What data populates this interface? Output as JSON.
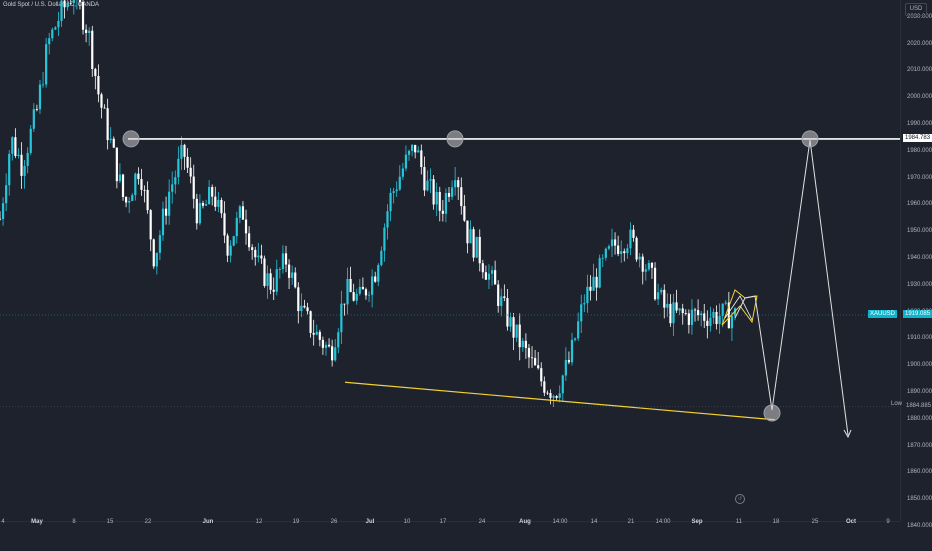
{
  "header": {
    "symbol_title": "Gold Spot / U.S. Dollar, 1D, OANDA",
    "currency": "USD"
  },
  "colors": {
    "background": "#1e222d",
    "candle_up": "#26c6da",
    "candle_down": "#ffffff",
    "resistance_line": "#ffffff",
    "support_line": "#f5d033",
    "triangle": "#f5d033",
    "projection_path": "#e0e0e0",
    "current_price_tag": "#0fb3cc",
    "resistance_tag_bg": "#ffffff"
  },
  "price_scale": {
    "labels": [
      "2030.000",
      "2020.000",
      "2010.000",
      "2000.000",
      "1990.000",
      "1980.000",
      "1970.000",
      "1960.000",
      "1950.000",
      "1940.000",
      "1930.000",
      "1920.000",
      "1910.000",
      "1900.000",
      "1890.000",
      "1880.000",
      "1870.000",
      "1860.000",
      "1850.000",
      "1840.000"
    ]
  },
  "time_scale": {
    "labels": [
      "4",
      "May",
      "8",
      "15",
      "22",
      "Jun",
      "12",
      "19",
      "26",
      "Jul",
      "10",
      "17",
      "24",
      "Aug",
      "14:00",
      "14",
      "21",
      "14:00",
      "Sep",
      "11",
      "18",
      "25",
      "Oct",
      "9"
    ],
    "bold": [
      "May",
      "Jun",
      "Jul",
      "Aug",
      "Sep",
      "Oct"
    ]
  },
  "tags": {
    "resistance_price": "1984.783",
    "current_symbol": "XAUUSD",
    "current_price": "1919.085",
    "low_label": "Low",
    "low_price": "1884.885"
  },
  "buttons": {
    "reset": "↺"
  },
  "chart_data": {
    "type": "candlestick",
    "title": "Gold Spot / U.S. Dollar, 1D, OANDA",
    "ylim": [
      1838,
      2035
    ],
    "resistance_level": 1984.783,
    "current_price": 1919.085,
    "low": 1884.885,
    "support_trendline": [
      [
        0.0,
        1894
      ],
      [
        1.0,
        1880
      ]
    ],
    "price_path": [
      [
        0,
        1955
      ],
      [
        0.015,
        1985
      ],
      [
        0.03,
        1975
      ],
      [
        0.05,
        1995
      ],
      [
        0.065,
        2020
      ],
      [
        0.08,
        2030
      ],
      [
        0.1,
        2040
      ],
      [
        0.12,
        2025
      ],
      [
        0.135,
        2000
      ],
      [
        0.15,
        1984
      ],
      [
        0.17,
        1960
      ],
      [
        0.19,
        1975
      ],
      [
        0.21,
        1940
      ],
      [
        0.23,
        1965
      ],
      [
        0.25,
        1980
      ],
      [
        0.27,
        1955
      ],
      [
        0.29,
        1965
      ],
      [
        0.31,
        1945
      ],
      [
        0.33,
        1958
      ],
      [
        0.35,
        1938
      ],
      [
        0.37,
        1930
      ],
      [
        0.39,
        1940
      ],
      [
        0.41,
        1920
      ],
      [
        0.43,
        1912
      ],
      [
        0.45,
        1905
      ],
      [
        0.47,
        1928
      ],
      [
        0.49,
        1925
      ],
      [
        0.51,
        1935
      ],
      [
        0.53,
        1962
      ],
      [
        0.55,
        1975
      ],
      [
        0.565,
        1982
      ],
      [
        0.58,
        1968
      ],
      [
        0.6,
        1958
      ],
      [
        0.62,
        1975
      ],
      [
        0.635,
        1950
      ],
      [
        0.655,
        1940
      ],
      [
        0.675,
        1928
      ],
      [
        0.695,
        1915
      ],
      [
        0.715,
        1905
      ],
      [
        0.735,
        1895
      ],
      [
        0.755,
        1890
      ],
      [
        0.775,
        1902
      ],
      [
        0.795,
        1925
      ],
      [
        0.815,
        1935
      ],
      [
        0.835,
        1945
      ],
      [
        0.855,
        1948
      ],
      [
        0.875,
        1940
      ],
      [
        0.89,
        1930
      ],
      [
        0.905,
        1921
      ],
      [
        0.92,
        1919
      ]
    ],
    "projection": [
      [
        "Sep 11",
        1919
      ],
      [
        "Sep 13",
        1930
      ],
      [
        "Sep 15",
        1926
      ],
      [
        "Sep 18",
        1881
      ],
      [
        "Sep 25",
        1985
      ],
      [
        "Oct 2",
        1883
      ],
      [
        "Oct 5",
        1873
      ]
    ],
    "circle_markers": [
      [
        "May 18",
        1984.783
      ],
      [
        "Jul 19",
        1984.783
      ],
      [
        "Sep 17",
        1881
      ],
      [
        "Sep 25",
        1985
      ]
    ]
  }
}
